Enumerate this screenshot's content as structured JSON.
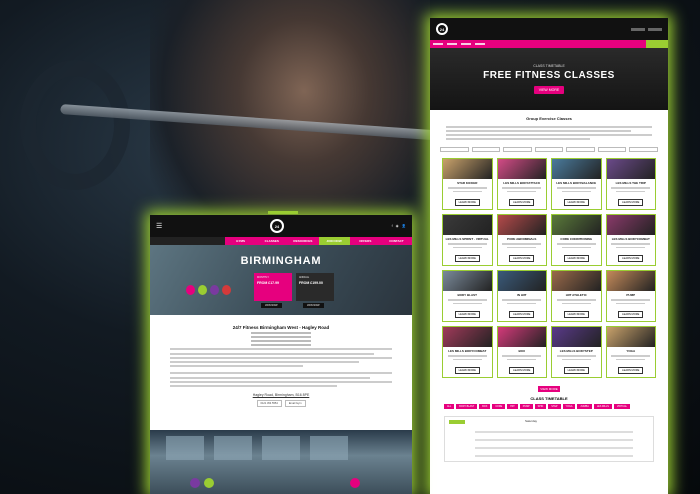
{
  "right_page": {
    "hero_kicker": "CLASS TIMETABLE",
    "hero_title": "FREE FITNESS CLASSES",
    "hero_button": "VIEW MORE",
    "section_title": "Group Exercise Classes",
    "cards": [
      {
        "title": "STAR KICKER",
        "color": "#c9a26b",
        "button": "LEARN MORE"
      },
      {
        "title": "LES MILLS BODYATTACK",
        "color": "#d34b86",
        "button": "LEARN MORE"
      },
      {
        "title": "LES MILLS BODYBALANCE",
        "color": "#4a7b9d",
        "button": "LEARN MORE"
      },
      {
        "title": "LES MILLS THE TRIP",
        "color": "#6b4a8a",
        "button": "LEARN MORE"
      },
      {
        "title": "LES MILLS SPRINT - VIRTUAL",
        "color": "#3a3a3a",
        "button": "LEARN MORE"
      },
      {
        "title": "PURE ABDOMINALS",
        "color": "#b44a4a",
        "button": "LEARN MORE"
      },
      {
        "title": "CORE CONDITIONING",
        "color": "#5a7a3a",
        "button": "LEARN MORE"
      },
      {
        "title": "LES MILLS BODYCOMBAT",
        "color": "#8a3a6a",
        "button": "LEARN MORE"
      },
      {
        "title": "BODY BLAST",
        "color": "#7a8a9a",
        "button": "LEARN MORE"
      },
      {
        "title": "IN HIIT",
        "color": "#3a5a7a",
        "button": "LEARN MORE"
      },
      {
        "title": "HIIT ATHLETIC",
        "color": "#9a6a4a",
        "button": "LEARN MORE"
      },
      {
        "title": "PUMP",
        "color": "#c48a5a",
        "button": "LEARN MORE"
      },
      {
        "title": "LES MILLS BODYCOMBAT",
        "color": "#a13a5a",
        "button": "LEARN MORE"
      },
      {
        "title": "BOX",
        "color": "#d43a7a",
        "button": "LEARN MORE"
      },
      {
        "title": "LES MILLS BODYSTEP",
        "color": "#5a3a8a",
        "button": "LEARN MORE"
      },
      {
        "title": "YOGA",
        "color": "#c9a26b",
        "button": "LEARN MORE"
      }
    ],
    "view_more": "VIEW MORE",
    "timetable_title": "CLASS TIMETABLE",
    "timetable_pills": [
      "ALL",
      "BODY BLAST",
      "BOX",
      "CORE",
      "HIIT",
      "PUMP",
      "SPIN",
      "STEP",
      "YOGA",
      "ZUMBA",
      "LES MILLS",
      "VIRTUAL"
    ],
    "timetable_head": "Saturday"
  },
  "left_page": {
    "nav_items": [
      "GYMS",
      "CLASSES",
      "RESOURCES",
      "JOIN NOW",
      "OFFERS",
      "CONTACT"
    ],
    "hero_title": "BIRMINGHAM",
    "price_left": {
      "label": "MONTHLY",
      "value": "FROM £17.99",
      "join": "JOIN NOW"
    },
    "price_right": {
      "label": "ANNUAL",
      "value": "FROM £199.00",
      "join": "JOIN NOW"
    },
    "gym_title": "24/7 Fitness Birmingham West - Hagley Road",
    "link_text": "Hagley Road, Birmingham, B16 8PE",
    "contact_phone": "0121 454 5554",
    "contact_email": "Email Gym"
  },
  "colors": {
    "pink": "#e6007e",
    "green": "#9acd32",
    "dark": "#111111"
  }
}
